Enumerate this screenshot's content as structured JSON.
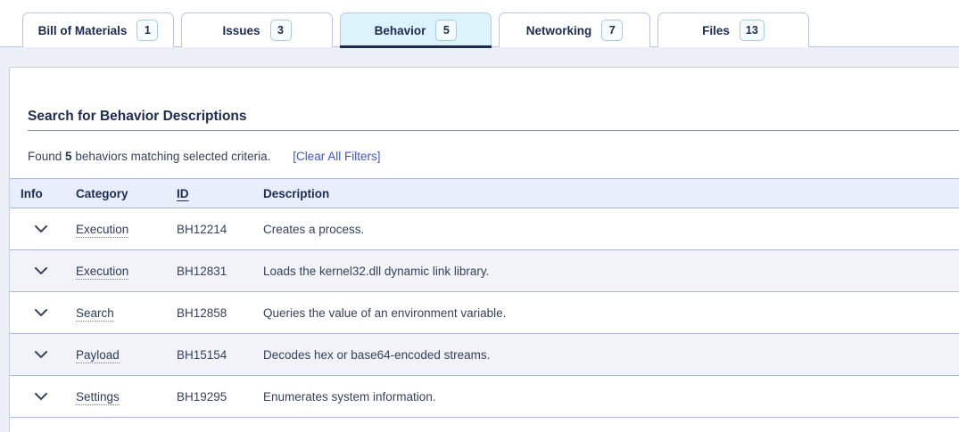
{
  "tabs": [
    {
      "label": "Bill of Materials",
      "count": "1",
      "active": false
    },
    {
      "label": "Issues",
      "count": "3",
      "active": false
    },
    {
      "label": "Behavior",
      "count": "5",
      "active": true
    },
    {
      "label": "Networking",
      "count": "7",
      "active": false
    },
    {
      "label": "Files",
      "count": "13",
      "active": false
    }
  ],
  "panel": {
    "heading": "Search for Behavior Descriptions",
    "summary": {
      "prefix": "Found",
      "count": "5",
      "suffix": " behaviors matching selected criteria.",
      "clear_link": "[Clear All Filters]"
    }
  },
  "table": {
    "columns": {
      "info": "Info",
      "category": "Category",
      "id": "ID",
      "description": "Description"
    },
    "rows": [
      {
        "category": "Execution",
        "id": "BH12214",
        "description": "Creates a process."
      },
      {
        "category": "Execution",
        "id": "BH12831",
        "description": "Loads the kernel32.dll dynamic link library."
      },
      {
        "category": "Search",
        "id": "BH12858",
        "description": "Queries the value of an environment variable."
      },
      {
        "category": "Payload",
        "id": "BH15154",
        "description": "Decodes hex or base64-encoded streams."
      },
      {
        "category": "Settings",
        "id": "BH19295",
        "description": "Enumerates system information."
      }
    ]
  },
  "icons": {
    "row_expand": "chevron-down-icon"
  },
  "colors": {
    "accent_navy": "#1c2b52",
    "active_tab_bg": "#ddf3fc",
    "active_tab_bar": "#1e2b50",
    "tab_border": "#b9c7e0",
    "header_band_bg": "#e8eefb",
    "row_stripe": "#f1f3f9",
    "table_border": "#a9b8d8",
    "link_blue": "#4055cc",
    "page_bg": "#edeff7"
  }
}
